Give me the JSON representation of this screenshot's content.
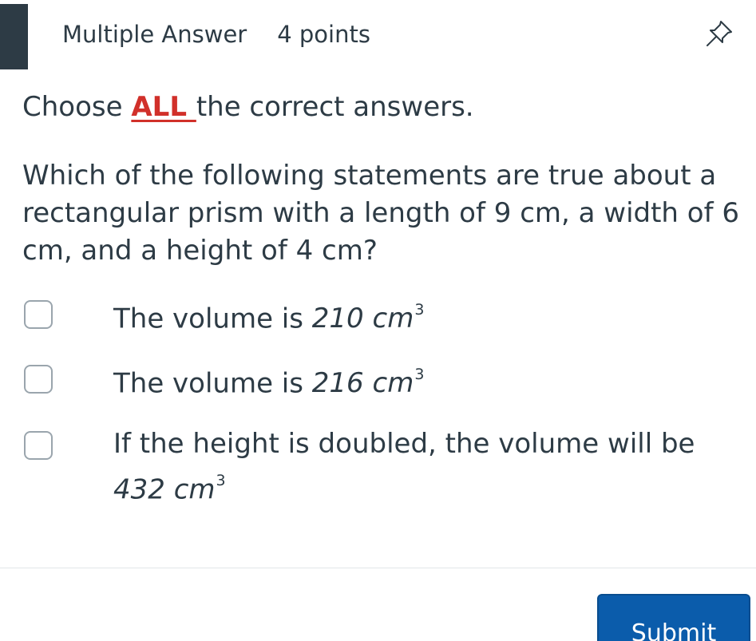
{
  "header": {
    "type_label": "Multiple Answer",
    "points_label": "4 points"
  },
  "instruction": {
    "prefix": "Choose ",
    "emphasis": "ALL ",
    "suffix": "the correct answers."
  },
  "question": {
    "text": "Which of the following statements are true about a rectangular prism with a length of 9 cm, a width of 6 cm, and a height of 4 cm?"
  },
  "options": [
    {
      "text": "The volume is ",
      "math_value": "210",
      "math_unit": "cm",
      "math_exp": "3",
      "checked": false
    },
    {
      "text": "The volume is ",
      "math_value": "216",
      "math_unit": "cm",
      "math_exp": "3",
      "checked": false
    },
    {
      "text": "If the height is doubled, the volume will be",
      "math_value": "432",
      "math_unit": "cm",
      "math_exp": "3",
      "checked": false
    }
  ],
  "submit": {
    "label": "Submit"
  },
  "colors": {
    "text": "#2d3b45",
    "emphasis": "#d1302a",
    "button": "#0b5cab",
    "checkbox_border": "#9aa5ad"
  },
  "icons": {
    "pin": "pin-icon"
  }
}
